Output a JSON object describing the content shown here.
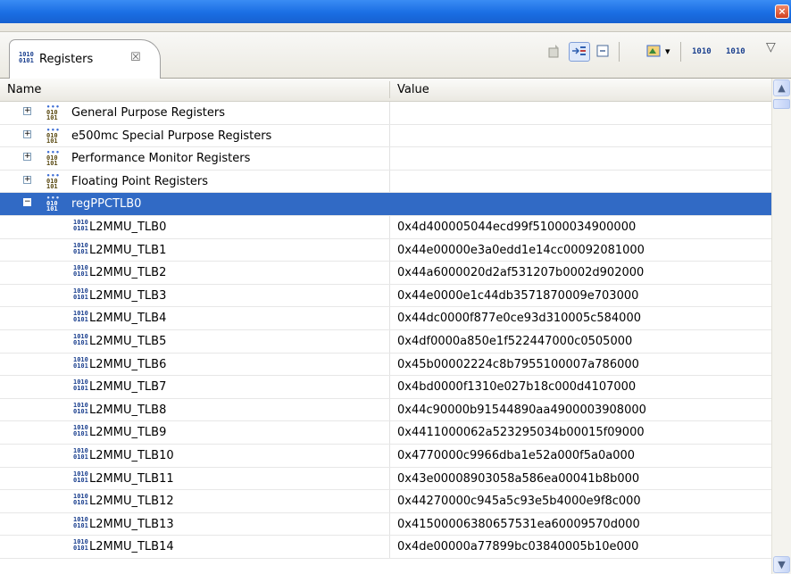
{
  "window": {
    "close_label": "×"
  },
  "view_tab": {
    "icon_line1": "1010",
    "icon_line2": "0101",
    "title": "Registers",
    "close_label": "☒"
  },
  "toolbar": {
    "format_label_1": "1010",
    "format_label_2": "1010",
    "menu_label": "▽",
    "dropdown_label": "▾"
  },
  "columns": {
    "name": "Name",
    "value": "Value"
  },
  "scrollbar": {
    "up": "▲",
    "down": "▼"
  },
  "groups": [
    {
      "name": "General Purpose Registers",
      "expanded": false
    },
    {
      "name": "e500mc Special Purpose Registers",
      "expanded": false
    },
    {
      "name": "Performance Monitor Registers",
      "expanded": false
    },
    {
      "name": "Floating Point Registers",
      "expanded": false
    }
  ],
  "selected_group": {
    "name": "regPPCTLB0",
    "expanded": true
  },
  "registers": [
    {
      "name": "L2MMU_TLB0",
      "value": "0x4d400005044ecd99f51000034900000"
    },
    {
      "name": "L2MMU_TLB1",
      "value": "0x44e00000e3a0edd1e14cc00092081000"
    },
    {
      "name": "L2MMU_TLB2",
      "value": "0x44a6000020d2af531207b0002d902000"
    },
    {
      "name": "L2MMU_TLB3",
      "value": "0x44e0000e1c44db3571870009e703000"
    },
    {
      "name": "L2MMU_TLB4",
      "value": "0x44dc0000f877e0ce93d310005c584000"
    },
    {
      "name": "L2MMU_TLB5",
      "value": "0x4df0000a850e1f522447000c0505000"
    },
    {
      "name": "L2MMU_TLB6",
      "value": "0x45b00002224c8b7955100007a786000"
    },
    {
      "name": "L2MMU_TLB7",
      "value": "0x4bd0000f1310e027b18c000d4107000"
    },
    {
      "name": "L2MMU_TLB8",
      "value": "0x44c90000b91544890aa4900003908000"
    },
    {
      "name": "L2MMU_TLB9",
      "value": "0x4411000062a523295034b00015f09000"
    },
    {
      "name": "L2MMU_TLB10",
      "value": "0x4770000c9966dba1e52a000f5a0a000"
    },
    {
      "name": "L2MMU_TLB11",
      "value": "0x43e00008903058a586ea00041b8b000"
    },
    {
      "name": "L2MMU_TLB12",
      "value": "0x44270000c945a5c93e5b4000e9f8c000"
    },
    {
      "name": "L2MMU_TLB13",
      "value": "0x41500006380657531ea60009570d000"
    },
    {
      "name": "L2MMU_TLB14",
      "value": "0x4de00000a77899bc03840005b10e000"
    }
  ],
  "icons": {
    "register": "register-1010-icon",
    "group": "register-group-icon",
    "expander_collapsed": "+",
    "expander_expanded": "−"
  }
}
